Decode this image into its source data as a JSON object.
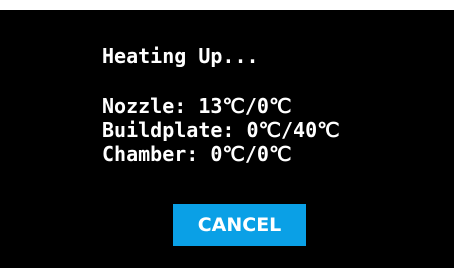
{
  "dialog": {
    "title": "Heating Up...",
    "status_lines": [
      "Nozzle: 13℃/0℃",
      "Buildplate: 0℃/40℃",
      "Chamber: 0℃/0℃"
    ],
    "cancel_label": "CANCEL"
  },
  "colors": {
    "background": "#000000",
    "text": "#ffffff",
    "accent": "#0aa0e6",
    "frame": "#ffffff"
  }
}
